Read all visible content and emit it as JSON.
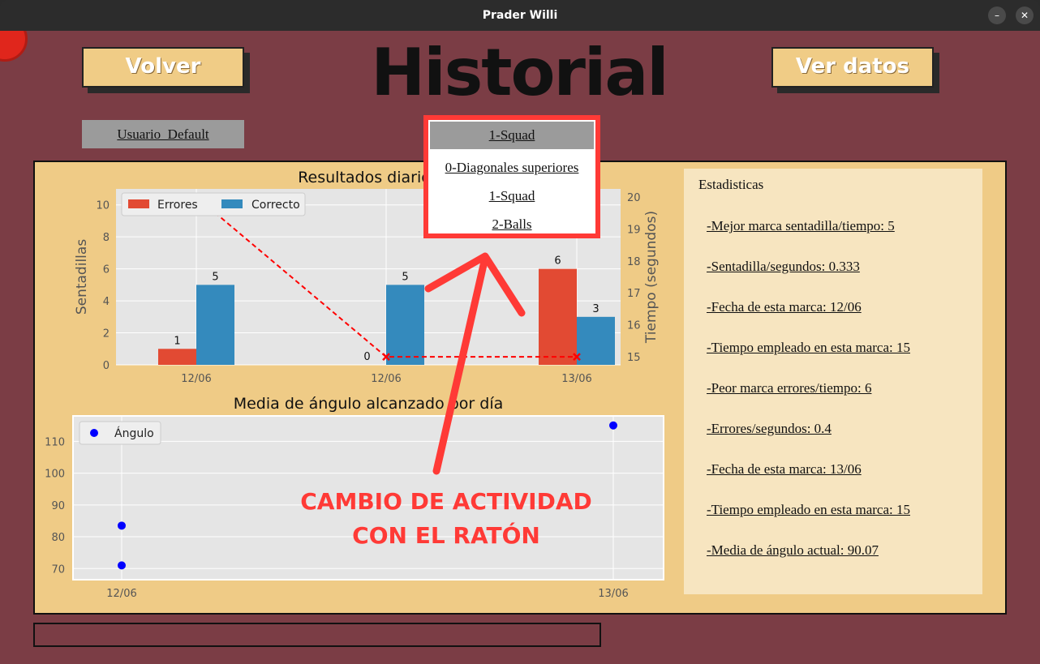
{
  "window": {
    "title": "Prader Willi"
  },
  "header": {
    "title": "Historial",
    "back_label": "Volver",
    "view_data_label": "Ver datos"
  },
  "user_select": {
    "value": "Usuario_Default"
  },
  "activity_select": {
    "selected": "1-Squad",
    "options": [
      "0-Diagonales superiores",
      "1-Squad",
      "2-Balls"
    ]
  },
  "annotation": {
    "line1": "CAMBIO DE ACTIVIDAD",
    "line2": "CON EL RATÓN"
  },
  "stats": {
    "title": "Estadisticas",
    "lines": [
      "-Mejor marca sentadilla/tiempo:  5",
      "-Sentadilla/segundos:  0.333",
      "-Fecha de esta marca:  12/06",
      "-Tiempo empleado en esta marca:  15",
      "-Peor marca errores/tiempo:  6",
      "-Errores/segundos:  0.4",
      "-Fecha de esta marca:  13/06",
      "-Tiempo empleado en esta marca:  15",
      "-Media de ángulo actual:  90.07"
    ]
  },
  "colors": {
    "errores": "#e24a33",
    "correcto": "#348abd",
    "tiempo": "#ff0000",
    "angulo": "#0000ff",
    "annotation": "#ff3a36"
  },
  "chart_data": [
    {
      "type": "bar",
      "title": "Resultados diarios",
      "categories": [
        "12/06",
        "12/06",
        "13/06"
      ],
      "series": [
        {
          "name": "Errores",
          "values": [
            1,
            0,
            6
          ]
        },
        {
          "name": "Correcto",
          "values": [
            5,
            5,
            3
          ]
        }
      ],
      "ylabel": "Sentadillas",
      "ylim": [
        0,
        11
      ],
      "yticks": [
        "0",
        "2",
        "4",
        "6",
        "8",
        "10"
      ],
      "secondary_axis": {
        "ylabel": "Tiempo (segundos)",
        "ylim": [
          14.75,
          20.25
        ],
        "yticks": [
          "15",
          "16",
          "17",
          "18",
          "19",
          "20"
        ],
        "line_values": [
          20,
          15,
          15
        ]
      },
      "legend_position": "top-left",
      "grid": true
    },
    {
      "type": "scatter",
      "title": "Media de ángulo alcanzado por día",
      "series": [
        {
          "name": "Ángulo",
          "points": [
            [
              "12/06",
              83.5
            ],
            [
              "12/06",
              71
            ],
            [
              "13/06",
              115
            ]
          ]
        }
      ],
      "xticks": [
        "12/06",
        "13/06"
      ],
      "ylim": [
        66.5,
        118
      ],
      "yticks": [
        "70",
        "80",
        "90",
        "100",
        "110"
      ],
      "legend_position": "top-left",
      "grid": true
    }
  ]
}
